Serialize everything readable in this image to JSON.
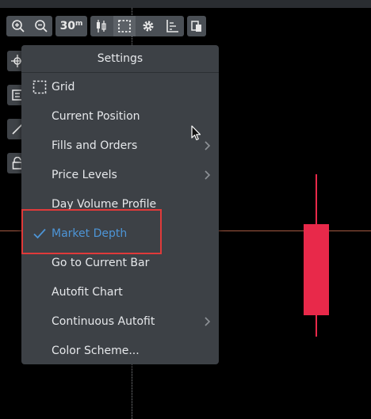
{
  "toolbar": {
    "timeframe": "30",
    "timeframe_unit": "m"
  },
  "menu": {
    "title": "Settings",
    "items": [
      {
        "label": "Grid",
        "icon": "grid-icon"
      },
      {
        "label": "Current Position"
      },
      {
        "label": "Fills and Orders",
        "submenu": true
      },
      {
        "label": "Price Levels",
        "submenu": true
      },
      {
        "label": "Day Volume Profile"
      },
      {
        "label": "Market Depth",
        "checked": true
      },
      {
        "label": "Go to Current Bar"
      },
      {
        "label": "Autofit Chart"
      },
      {
        "label": "Continuous Autofit",
        "submenu": true
      },
      {
        "label": "Color Scheme..."
      }
    ]
  },
  "colors": {
    "candle": "#e8294a",
    "checked_text": "#4d95d7",
    "highlight_box": "#e03a3a"
  }
}
